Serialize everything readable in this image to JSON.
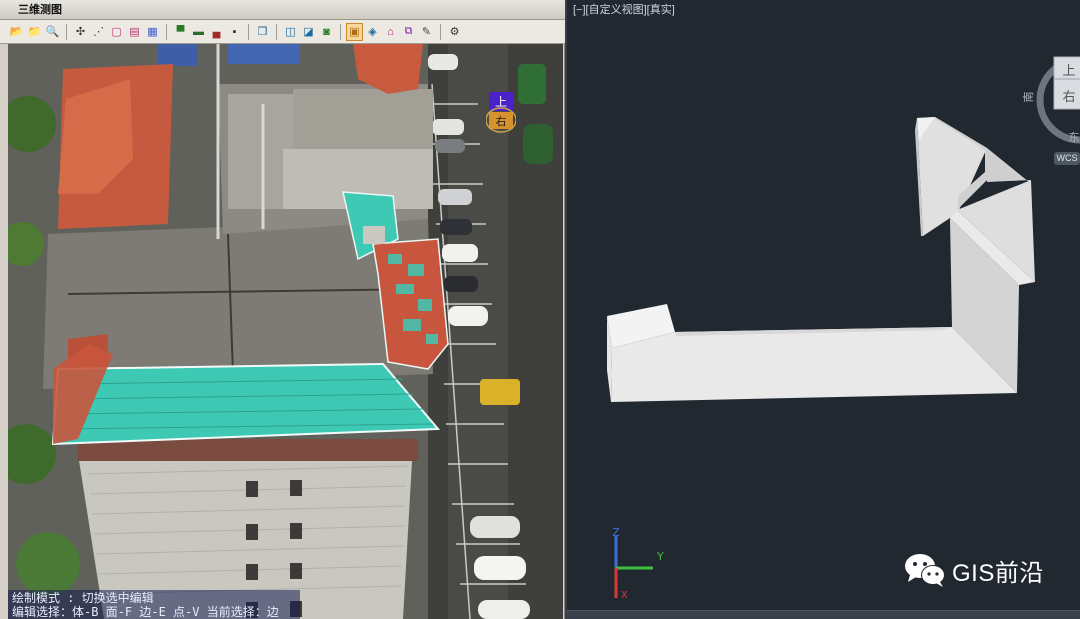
{
  "left_panel": {
    "title": "三维测图",
    "toolbar_icons": [
      "open-folder-icon",
      "folder-icon",
      "photo-search-icon",
      "sep",
      "point-pick-icon",
      "edit-points-icon",
      "box-icon",
      "faces-icon",
      "grid-icon",
      "sep",
      "layer-up-icon",
      "layer-mid-icon",
      "layer-down-icon",
      "layer-gray-icon",
      "sep",
      "layers-icon",
      "sep",
      "view-box-icon",
      "view-edge-icon",
      "camera-icon",
      "sep",
      "cube-active-icon",
      "cube-edit-icon",
      "shape-edit-icon",
      "copy-shape-icon",
      "note-icon",
      "sep",
      "settings-icon"
    ],
    "nav_cube": {
      "top": "上",
      "front": "右"
    },
    "status_lines": [
      "绘制模式 : 切换选中编辑",
      "编辑选择：体-B 面-F 边-E 点-V 当前选择：边"
    ]
  },
  "right_panel": {
    "view_label": "[−][自定义视图][真实]",
    "nav_compass": {
      "top": "上",
      "right": "右",
      "south": "南",
      "east": "东",
      "wcs": "WCS"
    },
    "ucs": {
      "x": "X",
      "y": "Y",
      "z": "Z"
    },
    "watermark": "GIS前沿"
  },
  "colors": {
    "dark_bg": "#212830",
    "teal_roof": "#3ec9b5",
    "red_roof": "#c8553e",
    "highlight": "#f7d79a"
  }
}
